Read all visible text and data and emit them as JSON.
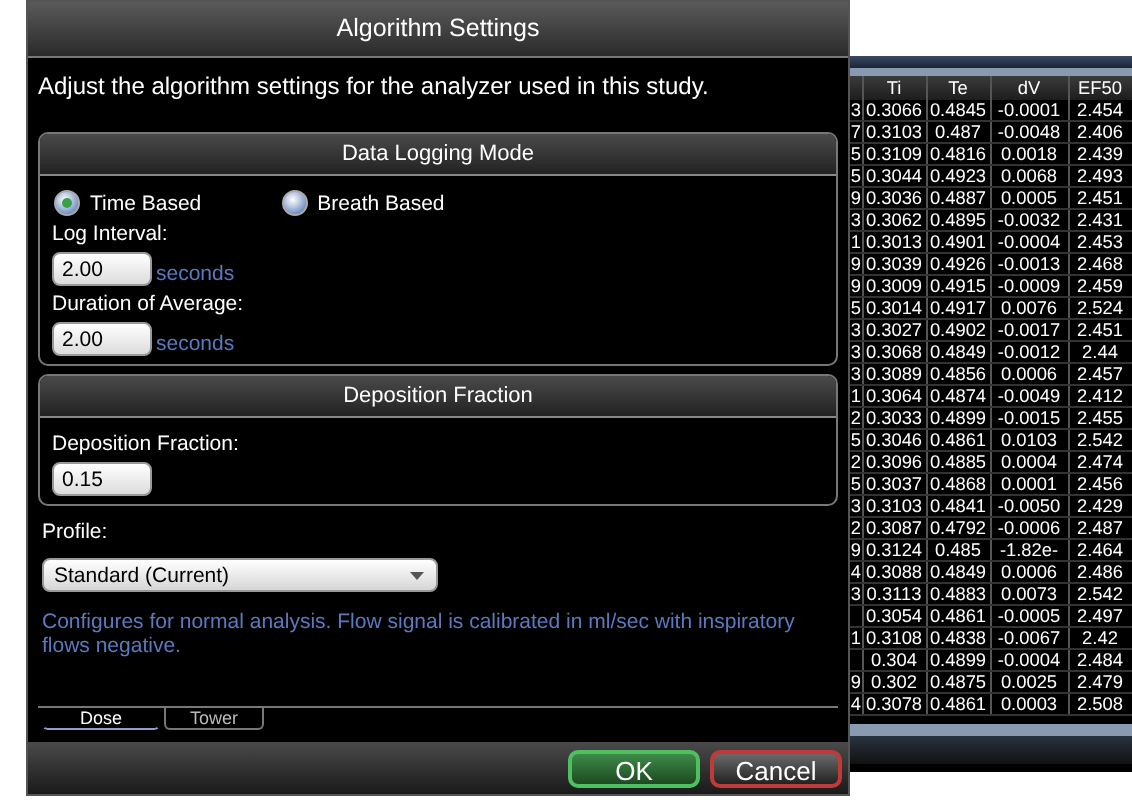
{
  "background_window": {
    "table": {
      "columns": [
        "Ti",
        "Te",
        "dV",
        "EF50"
      ],
      "rows": [
        {
          "column_1": "3",
          "values": [
            "0.3066",
            "0.4845",
            "-0.0001",
            "2.454"
          ]
        },
        {
          "column_1": "7",
          "values": [
            "0.3103",
            "0.487",
            "-0.0048",
            "2.406"
          ]
        },
        {
          "column_1": "5",
          "values": [
            "0.3109",
            "0.4816",
            "0.0018",
            "2.439"
          ]
        },
        {
          "column_1": "5",
          "values": [
            "0.3044",
            "0.4923",
            "0.0068",
            "2.493"
          ]
        },
        {
          "column_1": "9",
          "values": [
            "0.3036",
            "0.4887",
            "0.0005",
            "2.451"
          ]
        },
        {
          "column_1": "3",
          "values": [
            "0.3062",
            "0.4895",
            "-0.0032",
            "2.431"
          ]
        },
        {
          "column_1": "1",
          "values": [
            "0.3013",
            "0.4901",
            "-0.0004",
            "2.453"
          ]
        },
        {
          "column_1": "9",
          "values": [
            "0.3039",
            "0.4926",
            "-0.0013",
            "2.468"
          ]
        },
        {
          "column_1": "9",
          "values": [
            "0.3009",
            "0.4915",
            "-0.0009",
            "2.459"
          ]
        },
        {
          "column_1": "5",
          "values": [
            "0.3014",
            "0.4917",
            "0.0076",
            "2.524"
          ]
        },
        {
          "column_1": "3",
          "values": [
            "0.3027",
            "0.4902",
            "-0.0017",
            "2.451"
          ]
        },
        {
          "column_1": "3",
          "values": [
            "0.3068",
            "0.4849",
            "-0.0012",
            "2.44"
          ]
        },
        {
          "column_1": "3",
          "values": [
            "0.3089",
            "0.4856",
            "0.0006",
            "2.457"
          ]
        },
        {
          "column_1": "1",
          "values": [
            "0.3064",
            "0.4874",
            "-0.0049",
            "2.412"
          ]
        },
        {
          "column_1": "2",
          "values": [
            "0.3033",
            "0.4899",
            "-0.0015",
            "2.455"
          ]
        },
        {
          "column_1": "5",
          "values": [
            "0.3046",
            "0.4861",
            "0.0103",
            "2.542"
          ]
        },
        {
          "column_1": "2",
          "values": [
            "0.3096",
            "0.4885",
            "0.0004",
            "2.474"
          ]
        },
        {
          "column_1": "5",
          "values": [
            "0.3037",
            "0.4868",
            "0.0001",
            "2.456"
          ]
        },
        {
          "column_1": "3",
          "values": [
            "0.3103",
            "0.4841",
            "-0.0050",
            "2.429"
          ]
        },
        {
          "column_1": "2",
          "values": [
            "0.3087",
            "0.4792",
            "-0.0006",
            "2.487"
          ]
        },
        {
          "column_1": "9",
          "values": [
            "0.3124",
            "0.485",
            "-1.82e-",
            "2.464"
          ]
        },
        {
          "column_1": "4",
          "values": [
            "0.3088",
            "0.4849",
            "0.0006",
            "2.486"
          ]
        },
        {
          "column_1": "3",
          "values": [
            "0.3113",
            "0.4883",
            "0.0073",
            "2.542"
          ]
        },
        {
          "values": [
            "0.3054",
            "0.4861",
            "-0.0005",
            "2.497"
          ]
        },
        {
          "column_1": "1",
          "values": [
            "0.3108",
            "0.4838",
            "-0.0067",
            "2.42"
          ]
        },
        {
          "values": [
            "0.304",
            "0.4899",
            "-0.0004",
            "2.484"
          ]
        },
        {
          "column_1": "9",
          "values": [
            "0.302",
            "0.4875",
            "0.0025",
            "2.479"
          ]
        },
        {
          "column_1": "4",
          "values": [
            "0.3078",
            "0.4861",
            "0.0003",
            "2.508"
          ]
        }
      ]
    }
  },
  "dialog": {
    "title": "Algorithm Settings",
    "intro": "Adjust the algorithm settings for the analyzer used in this study.",
    "data_logging_mode": {
      "title": "Data Logging Mode",
      "modes": [
        {
          "label": "Time Based",
          "selected": true
        },
        {
          "label": "Breath Based",
          "selected": false
        }
      ],
      "fields": [
        {
          "label": "Log Interval:",
          "value": "2.00",
          "unit": "seconds"
        },
        {
          "label": "Duration of Average:",
          "value": "2.00",
          "unit": "seconds"
        }
      ]
    },
    "deposition_fraction": {
      "title": "Deposition Fraction",
      "fields": [
        {
          "label": "Deposition Fraction:",
          "value": "0.15"
        }
      ]
    },
    "profile": {
      "label": "Profile:",
      "value": "Standard (Current)",
      "description": "Configures for normal analysis.  Flow signal is calibrated in ml/sec with inspiratory flows negative."
    },
    "tabs": [
      {
        "label": "Dose",
        "selected": true
      },
      {
        "label": "Tower",
        "selected": false
      }
    ],
    "buttons": [
      {
        "label": "OK",
        "kind": "confirm"
      },
      {
        "label": "Cancel",
        "kind": "cancel"
      }
    ]
  }
}
